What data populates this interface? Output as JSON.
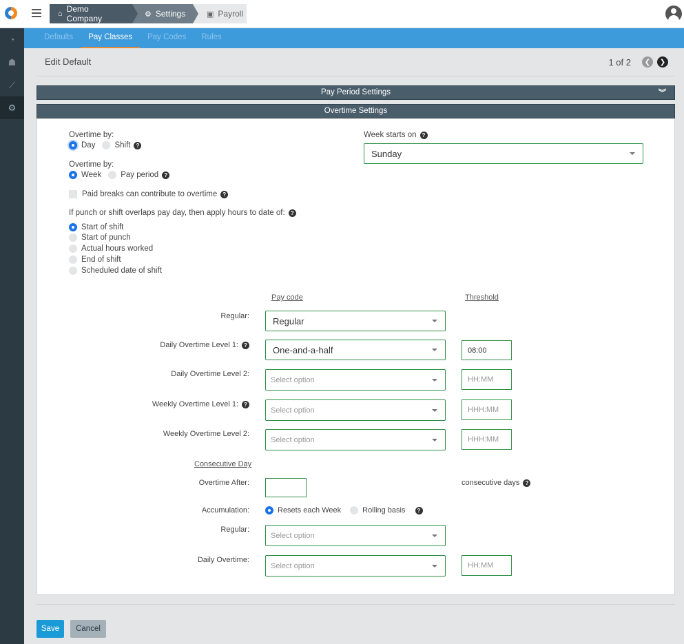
{
  "topbar": {
    "breadcrumbs": [
      {
        "label": "Demo Company",
        "icon": "home-icon"
      },
      {
        "label": "Settings",
        "icon": "gear-icon"
      },
      {
        "label": "Payroll",
        "icon": "money-icon"
      }
    ]
  },
  "sidebar": {
    "items": [
      {
        "icon": "dashboard-icon"
      },
      {
        "icon": "users-icon"
      },
      {
        "icon": "chart-icon"
      },
      {
        "icon": "gear-icon",
        "active": true
      }
    ]
  },
  "subnav": {
    "tabs": [
      "Defaults",
      "Pay Classes",
      "Pay Codes",
      "Rules"
    ],
    "active": "Pay Classes"
  },
  "page": {
    "title": "Edit Default",
    "pager": "1 of 2"
  },
  "sections": {
    "pay_period": "Pay Period Settings",
    "overtime": "Overtime Settings"
  },
  "overtime": {
    "by_label_1": "Overtime by:",
    "by_options_1": [
      "Day",
      "Shift"
    ],
    "by_label_2": "Overtime by:",
    "by_options_2": [
      "Week",
      "Pay period"
    ],
    "paid_breaks": "Paid breaks can contribute to overtime",
    "overlap_label": "If punch or shift overlaps pay day, then apply hours to date of:",
    "overlap_options": [
      "Start of shift",
      "Start of punch",
      "Actual hours worked",
      "End of shift",
      "Scheduled date of shift"
    ],
    "week_starts_label": "Week starts on",
    "week_starts_value": "Sunday"
  },
  "table": {
    "col_paycode": "Pay code",
    "col_threshold": "Threshold",
    "rows": {
      "regular_label": "Regular:",
      "regular_value": "Regular",
      "daily1_label": "Daily Overtime Level 1:",
      "daily1_value": "One-and-a-half",
      "daily1_threshold": "08:00",
      "daily2_label": "Daily Overtime Level 2:",
      "daily2_placeholder": "Select option",
      "daily2_threshold_ph": "HH:MM",
      "weekly1_label": "Weekly Overtime Level 1:",
      "weekly1_placeholder": "Select option",
      "weekly1_threshold_ph": "HHH:MM",
      "weekly2_label": "Weekly Overtime Level 2:",
      "weekly2_placeholder": "Select option",
      "weekly2_threshold_ph": "HHH:MM"
    }
  },
  "consecutive": {
    "heading": "Consecutive Day",
    "after_label": "Overtime After:",
    "after_value": "",
    "days_label": "consecutive days",
    "accum_label": "Accumulation:",
    "accum_options": [
      "Resets each Week",
      "Rolling basis"
    ],
    "regular_label": "Regular:",
    "regular_placeholder": "Select option",
    "daily_label": "Daily Overtime:",
    "daily_placeholder": "Select option",
    "daily_threshold_ph": "HH:MM"
  },
  "actions": {
    "save": "Save",
    "cancel": "Cancel"
  },
  "colors": {
    "accent_blue": "#3d9adb",
    "sidebar": "#2c3a44",
    "section_bar": "#4a5d6a",
    "input_border": "#2f8f46",
    "save_button": "#1a9bd7",
    "active_tab_underline": "#e08a3a"
  }
}
